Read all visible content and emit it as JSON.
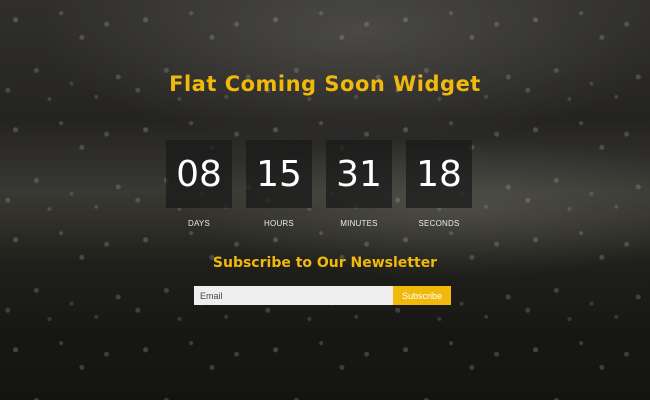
{
  "page": {
    "title": "Flat Coming Soon Widget",
    "accent_color": "#f0b90c"
  },
  "countdown": [
    {
      "value": "08",
      "label": "DAYS"
    },
    {
      "value": "15",
      "label": "HOURS"
    },
    {
      "value": "31",
      "label": "MINUTES"
    },
    {
      "value": "18",
      "label": "SECONDS"
    }
  ],
  "newsletter": {
    "heading": "Subscribe to Our Newsletter",
    "email_placeholder": "Email",
    "button_label": "Subscribe"
  }
}
